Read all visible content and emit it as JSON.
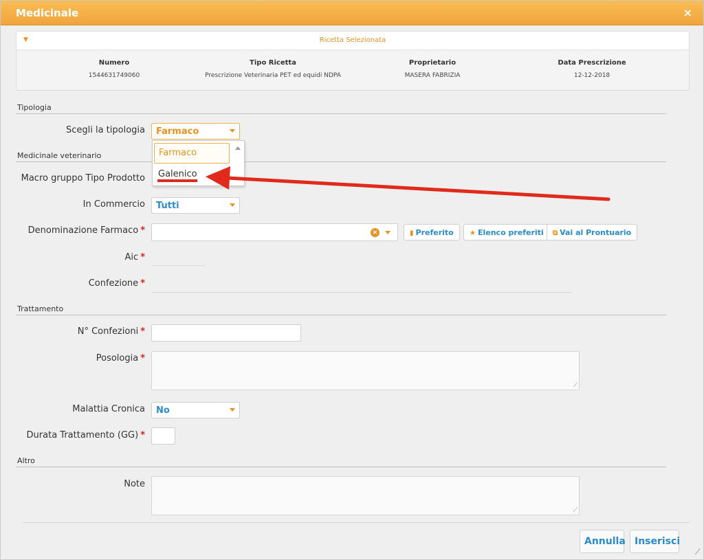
{
  "dialog": {
    "title": "Medicinale",
    "close_glyph": "×"
  },
  "recipe": {
    "title": "Ricetta Selezionata",
    "columns": [
      {
        "label": "Numero",
        "value": "1544631749060"
      },
      {
        "label": "Tipo Ricetta",
        "value": "Prescrizione Veterinaria PET ed equidi NDPA"
      },
      {
        "label": "Proprietario",
        "value": "MASERA FABRIZIA"
      },
      {
        "label": "Data Prescrizione",
        "value": "12-12-2018"
      }
    ]
  },
  "sections": {
    "tipologia": "Tipologia",
    "medicinale": "Medicinale veterinario",
    "trattamento": "Trattamento",
    "altro": "Altro"
  },
  "fields": {
    "tipologia_label": "Scegli la tipologia",
    "tipologia_value": "Farmaco",
    "macro_label": "Macro gruppo Tipo Prodotto",
    "commercio_label": "In Commercio",
    "commercio_value": "Tutti",
    "denominazione_label": "Denominazione Farmaco",
    "aic_label": "Aic",
    "confezione_label": "Confezione",
    "nconfezioni_label": "N° Confezioni",
    "posologia_label": "Posologia",
    "malattia_label": "Malattia Cronica",
    "malattia_value": "No",
    "durata_label": "Durata Trattamento (GG)",
    "note_label": "Note",
    "required_mark": "*"
  },
  "dropdown": {
    "options": [
      "Farmaco",
      "Galenico"
    ]
  },
  "buttons": {
    "preferito": "Preferito",
    "elenco_preferiti": "Elenco preferiti",
    "prontuario": "Vai al Prontuario",
    "annulla": "Annulla",
    "inserisci": "Inserisci"
  },
  "colors": {
    "accent_orange": "#e8921e",
    "link_blue": "#2a8cc8",
    "required_red": "#d9261c",
    "annotation_red": "#e02b1c"
  }
}
